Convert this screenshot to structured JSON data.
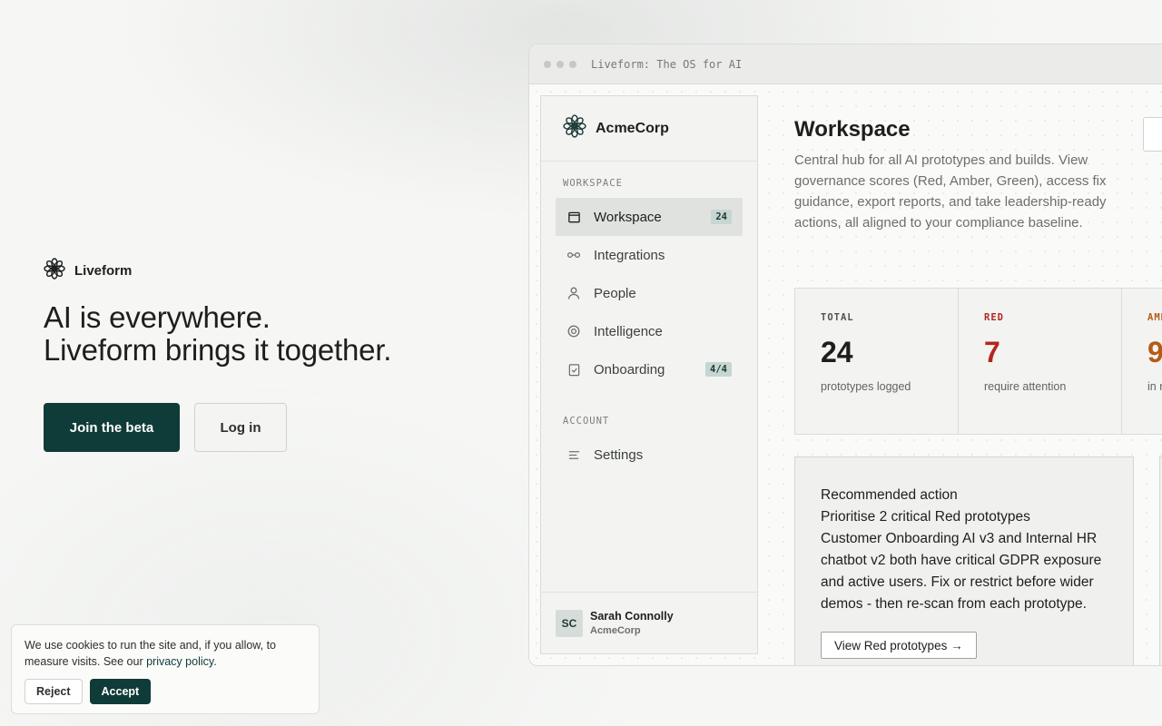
{
  "hero": {
    "brand": "Liveform",
    "title_line1": "AI is everywhere.",
    "title_line2": "Liveform brings it together.",
    "cta_primary": "Join the beta",
    "cta_secondary": "Log in"
  },
  "cookie": {
    "text": "We use cookies to run the site and, if you allow, to measure visits. See our ",
    "link": "privacy policy",
    "text_end": ".",
    "reject": "Reject",
    "accept": "Accept"
  },
  "window": {
    "title": "Liveform: The OS for AI"
  },
  "sidebar": {
    "org": "AcmeCorp",
    "section_workspace": "WORKSPACE",
    "section_account": "ACCOUNT",
    "items": [
      {
        "label": "Workspace",
        "badge": "24",
        "icon": "window-icon"
      },
      {
        "label": "Integrations",
        "badge": "",
        "icon": "link-icon"
      },
      {
        "label": "People",
        "badge": "",
        "icon": "person-icon"
      },
      {
        "label": "Intelligence",
        "badge": "",
        "icon": "target-icon"
      },
      {
        "label": "Onboarding",
        "badge": "4/4",
        "icon": "checklist-icon"
      }
    ],
    "account_items": [
      {
        "label": "Settings",
        "icon": "settings-lines-icon"
      }
    ],
    "user": {
      "initials": "SC",
      "name": "Sarah Connolly",
      "org": "AcmeCorp"
    }
  },
  "main": {
    "title": "Workspace",
    "description": "Central hub for all AI prototypes and builds. View governance scores (Red, Amber, Green), access fix guidance, export reports, and take leadership-ready actions, all aligned to your compliance baseline.",
    "stats": [
      {
        "label": "TOTAL",
        "value": "24",
        "sub": "prototypes logged",
        "color": "#1c1f1e"
      },
      {
        "label": "RED",
        "value": "7",
        "sub": "require attention",
        "color": "#b3261e"
      },
      {
        "label": "AMBER",
        "value": "9",
        "sub": "in review",
        "color": "#b65a16"
      }
    ],
    "recommended": {
      "heading": "Recommended action",
      "title": "Prioritise 2 critical Red prototypes",
      "body": "Customer Onboarding AI v3 and Internal HR chatbot v2 both have critical GDPR exposure and active users. Fix or restrict before wider demos - then re-scan from each prototype.",
      "button": "View Red prototypes →"
    }
  }
}
